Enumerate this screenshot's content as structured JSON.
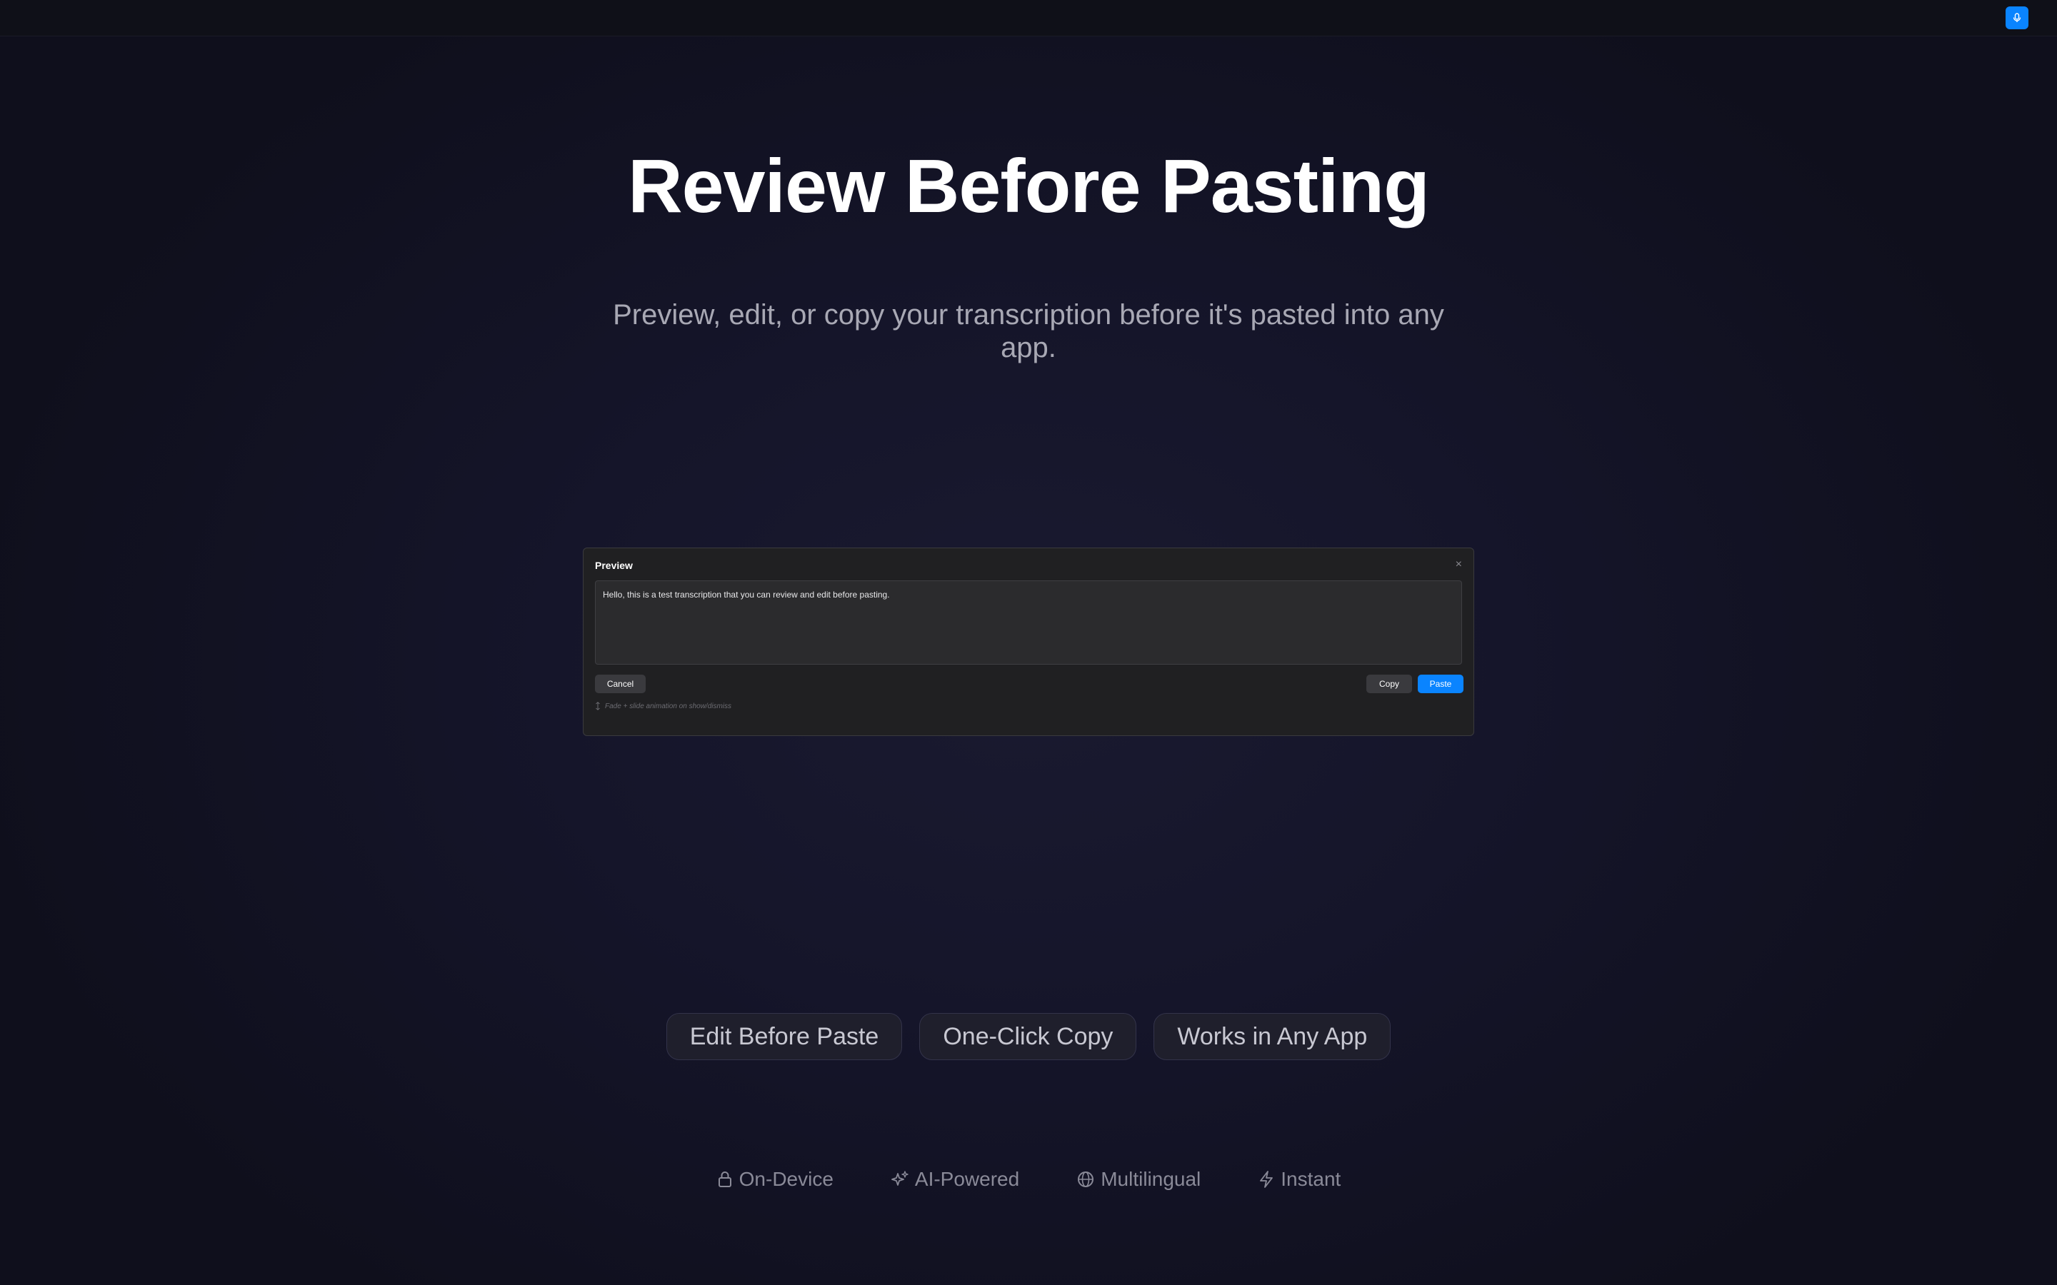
{
  "hero": {
    "title": "Review Before Pasting",
    "subtitle": "Preview, edit, or copy your transcription before it's pasted into any app."
  },
  "preview_panel": {
    "title": "Preview",
    "close_glyph": "×",
    "text": "Hello, this is a test transcription that you can review and edit before pasting.",
    "cancel_label": "Cancel",
    "copy_label": "Copy",
    "paste_label": "Paste",
    "hint": "Fade + slide animation on show/dismiss"
  },
  "pills": [
    {
      "label": "Edit Before Paste"
    },
    {
      "label": "One-Click Copy"
    },
    {
      "label": "Works in Any App"
    }
  ],
  "features": [
    {
      "icon": "lock-icon",
      "label": "On-Device"
    },
    {
      "icon": "sparkles-icon",
      "label": "AI-Powered"
    },
    {
      "icon": "globe-icon",
      "label": "Multilingual"
    },
    {
      "icon": "lightning-icon",
      "label": "Instant"
    }
  ],
  "colors": {
    "accent": "#0a84ff",
    "background": "#15152a",
    "panel": "#202022"
  }
}
